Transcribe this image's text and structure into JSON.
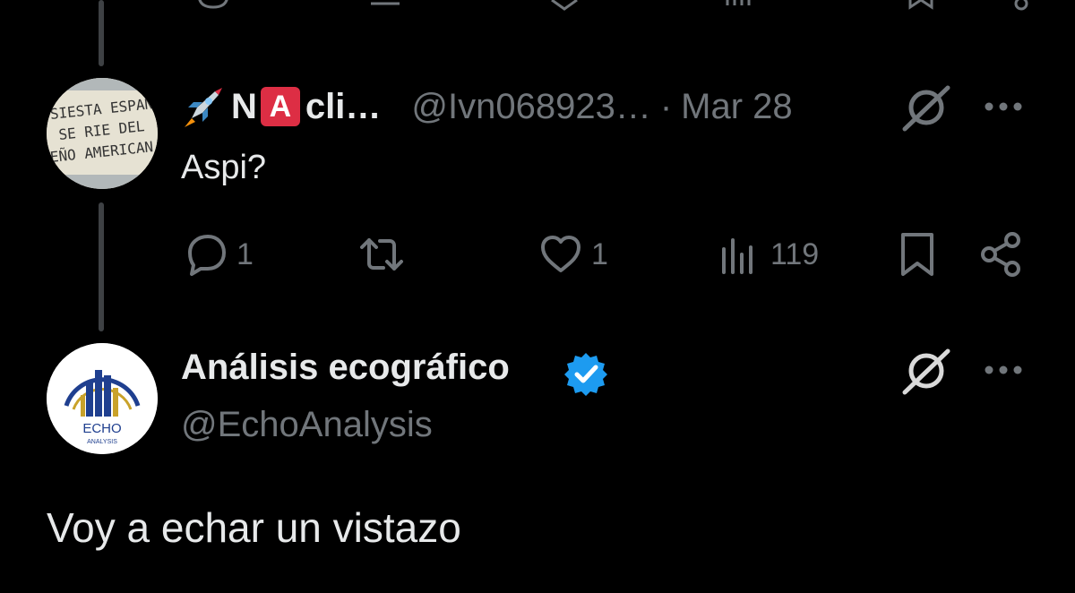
{
  "reply_tweet": {
    "display_name": "cli…",
    "name_letter_n": "N",
    "name_letter_a": "A",
    "handle": "@Ivn068923…",
    "separator": "·",
    "date": "Mar 28",
    "text": "Aspi?",
    "avatar_lines": [
      "SIESTA ESPAN",
      "SE RIE DEL",
      "EÑO AMERICAN"
    ],
    "actions": {
      "replies": "1",
      "reposts": "",
      "likes": "1",
      "views": "119"
    }
  },
  "main_tweet": {
    "display_name": "Análisis ecográfico",
    "handle": "@EchoAnalysis",
    "text": "Voy a echar un vistazo",
    "avatar_text": "ECHO",
    "avatar_subtext": "ANALYSIS",
    "verified_color": "#1d9bf0"
  },
  "icons": [
    "reply-icon",
    "repost-icon",
    "like-icon",
    "views-icon",
    "bookmark-icon",
    "share-icon",
    "grok-icon",
    "more-icon",
    "verified-badge-icon",
    "rocket-icon"
  ],
  "colors": {
    "background": "#000000",
    "text_primary": "#e7e9ea",
    "text_secondary": "#71767b",
    "thread_line": "#3e4144",
    "accent_blue": "#1d9bf0"
  }
}
